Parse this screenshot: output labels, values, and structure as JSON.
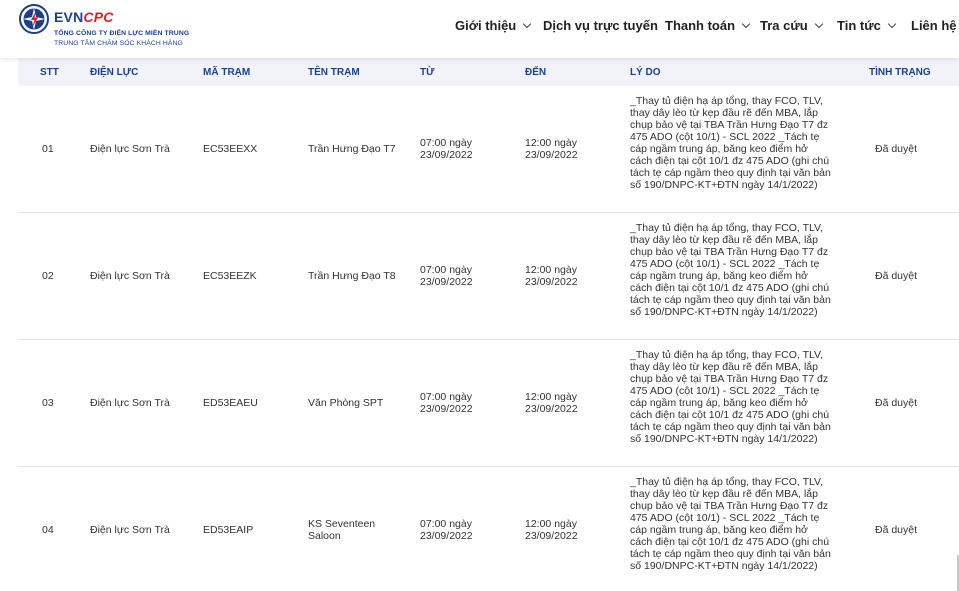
{
  "header": {
    "brand_a": "EVN",
    "brand_b": "CPC",
    "subtitle_1": "TỔNG CÔNG TY ĐIỆN LỰC MIỀN TRUNG",
    "subtitle_2": "TRUNG TÂM CHĂM SÓC KHÁCH HÀNG",
    "brand_colors": {
      "primary": "#1d3f8f",
      "accent": "#e31d24"
    }
  },
  "nav": [
    {
      "label": "Giới thiệu",
      "dropdown": true
    },
    {
      "label": "Dịch vụ trực tuyến",
      "dropdown": false
    },
    {
      "label": "Thanh toán",
      "dropdown": true
    },
    {
      "label": "Tra cứu",
      "dropdown": true
    },
    {
      "label": "Tin tức",
      "dropdown": true
    },
    {
      "label": "Liên hệ",
      "dropdown": false
    }
  ],
  "table": {
    "columns": [
      "STT",
      "ĐIỆN LỰC",
      "MÃ TRẠM",
      "TÊN TRẠM",
      "TỪ",
      "ĐẾN",
      "LÝ DO",
      "TÌNH TRẠNG"
    ],
    "rows": [
      {
        "stt": "01",
        "dien_luc": "Điện lực Sơn Trà",
        "ma_tram": "EC53EEXX",
        "ten_tram": "Trần Hưng Đạo T7",
        "tu_time": "07:00 ngày",
        "tu_date": "23/09/2022",
        "den_time": "12:00 ngày",
        "den_date": "23/09/2022",
        "ly_do": "_Thay tủ điện hạ áp tổng, thay FCO, TLV, thay dây lèo từ kẹp đầu rẽ đến MBA, lắp chụp bảo vệ tại TBA Trần Hưng Đạo T7 đz 475 ADO (cột 10/1) - SCL 2022 _Tách tẹ cáp ngầm trung áp, băng keo điểm hở cách điện tại cột 10/1 đz 475 ADO (ghi chú tách tẹ cáp ngầm theo quy định tại văn bản số 190/DNPC-KT+ĐTN ngày 14/1/2022)",
        "tinh_trang": "Đã duyệt"
      },
      {
        "stt": "02",
        "dien_luc": "Điện lực Sơn Trà",
        "ma_tram": "EC53EEZK",
        "ten_tram": "Trần Hưng Đạo T8",
        "tu_time": "07:00 ngày",
        "tu_date": "23/09/2022",
        "den_time": "12:00 ngày",
        "den_date": "23/09/2022",
        "ly_do": "_Thay tủ điện hạ áp tổng, thay FCO, TLV, thay dây lèo từ kẹp đầu rẽ đến MBA, lắp chụp bảo vệ tại TBA Trần Hưng Đạo T7 đz 475 ADO (cột 10/1) - SCL 2022 _Tách tẹ cáp ngầm trung áp, băng keo điểm hở cách điện tại cột 10/1 đz 475 ADO (ghi chú tách tẹ cáp ngầm theo quy định tại văn bản số 190/DNPC-KT+ĐTN ngày 14/1/2022)",
        "tinh_trang": "Đã duyệt"
      },
      {
        "stt": "03",
        "dien_luc": "Điện lực Sơn Trà",
        "ma_tram": "ED53EAEU",
        "ten_tram": "Văn Phòng SPT",
        "tu_time": "07:00 ngày",
        "tu_date": "23/09/2022",
        "den_time": "12:00 ngày",
        "den_date": "23/09/2022",
        "ly_do": "_Thay tủ điện hạ áp tổng, thay FCO, TLV, thay dây lèo từ kẹp đầu rẽ đến MBA, lắp chụp bảo vệ tại TBA Trần Hưng Đạo T7 đz 475 ADO (cột 10/1) - SCL 2022 _Tách tẹ cáp ngầm trung áp, băng keo điểm hở cách điện tại cột 10/1 đz 475 ADO (ghi chú tách tẹ cáp ngầm theo quy định tại văn bản số 190/DNPC-KT+ĐTN ngày 14/1/2022)",
        "tinh_trang": "Đã duyệt"
      },
      {
        "stt": "04",
        "dien_luc": "Điện lực Sơn Trà",
        "ma_tram": "ED53EAIP",
        "ten_tram": "KS Seventeen Saloon",
        "tu_time": "07:00 ngày",
        "tu_date": "23/09/2022",
        "den_time": "12:00 ngày",
        "den_date": "23/09/2022",
        "ly_do": "_Thay tủ điện hạ áp tổng, thay FCO, TLV, thay dây lèo từ kẹp đầu rẽ đến MBA, lắp chụp bảo vệ tại TBA Trần Hưng Đạo T7 đz 475 ADO (cột 10/1) - SCL 2022 _Tách tẹ cáp ngầm trung áp, băng keo điểm hở cách điện tại cột 10/1 đz 475 ADO (ghi chú tách tẹ cáp ngầm theo quy định tại văn bản số 190/DNPC-KT+ĐTN ngày 14/1/2022)",
        "tinh_trang": "Đã duyệt"
      }
    ]
  }
}
